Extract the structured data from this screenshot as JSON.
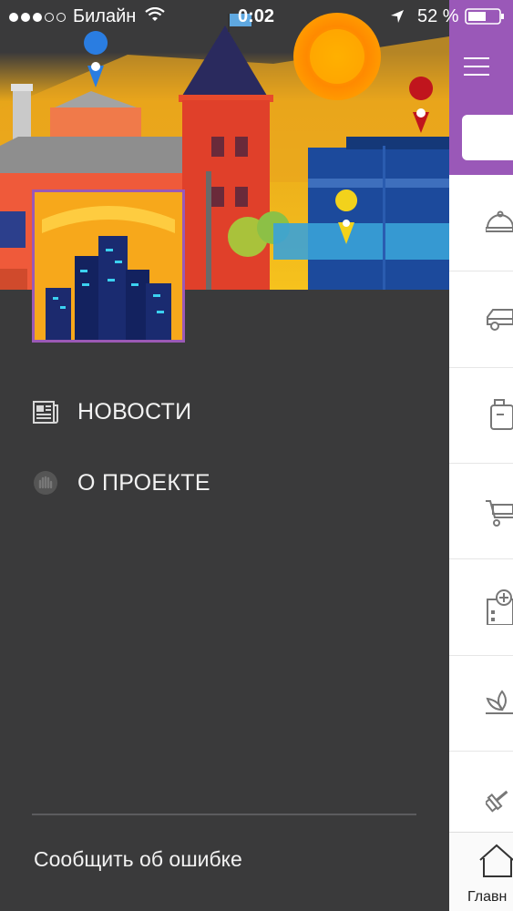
{
  "status_bar": {
    "carrier": "Билайн",
    "time": "0:02",
    "battery": "52 %"
  },
  "drawer": {
    "menu": [
      {
        "label": "НОВОСТИ",
        "icon": "newspaper-icon"
      },
      {
        "label": "О ПРОЕКТЕ",
        "icon": "hand-icon"
      }
    ],
    "report_label": "Сообщить об ошибке"
  },
  "main": {
    "tab_label": "Главн",
    "categories": [
      "restaurant-icon",
      "car-icon",
      "luggage-icon",
      "shopping-cart-icon",
      "hospital-icon",
      "spa-lotus-icon",
      "fitness-icon"
    ]
  },
  "colors": {
    "drawer_bg": "#3a3a3b",
    "accent_purple": "#9a58b8",
    "banner_sky": "#f3b81a"
  }
}
